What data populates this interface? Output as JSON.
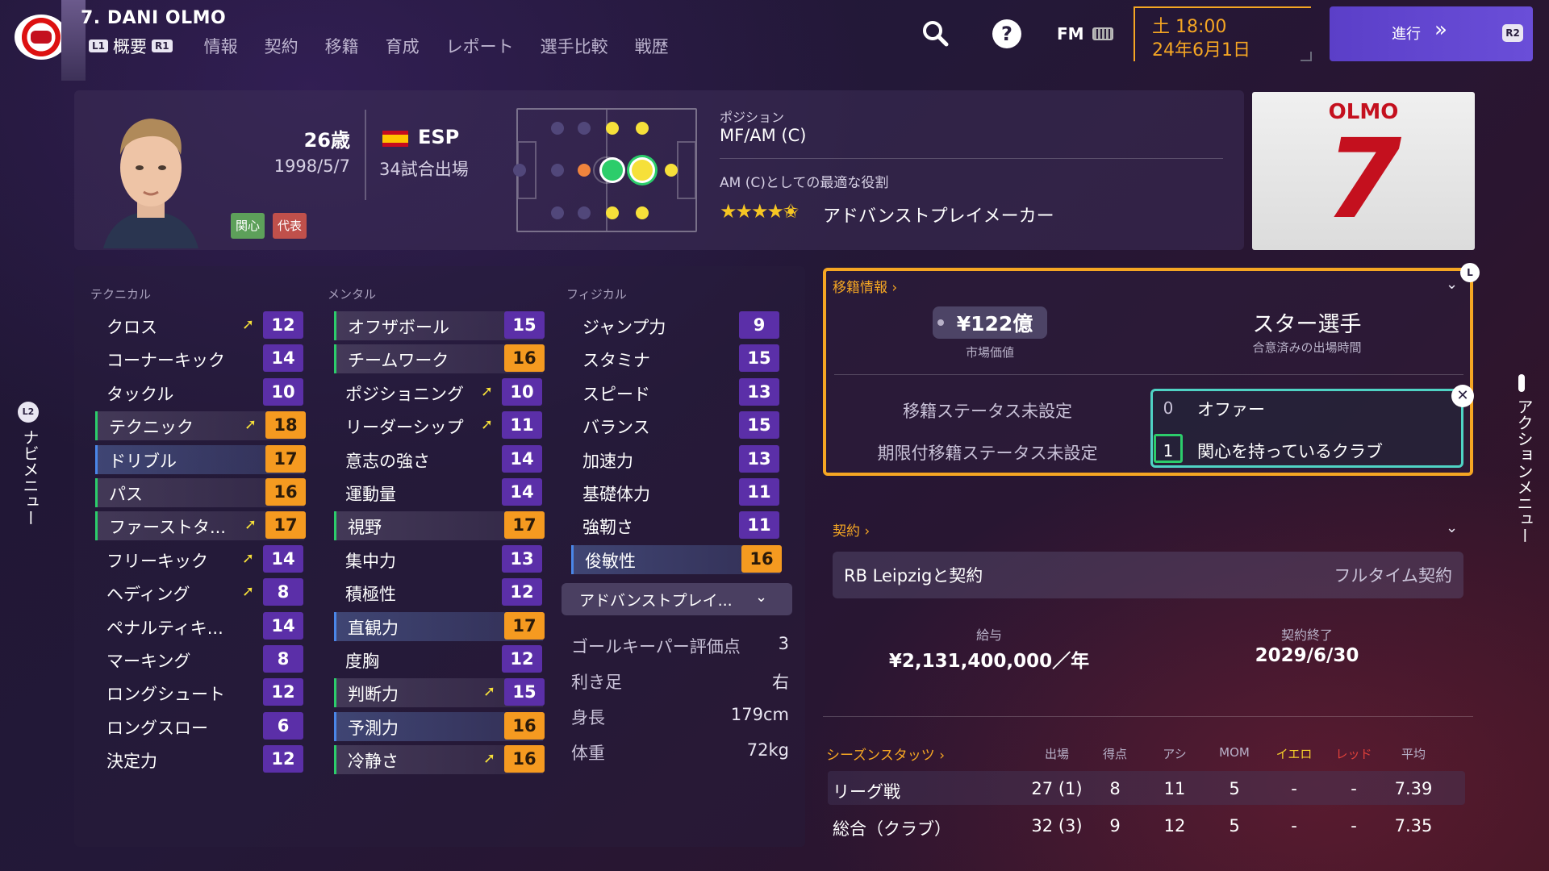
{
  "header": {
    "player_title": "7. DANI OLMO",
    "tabs": [
      {
        "label": "概要",
        "left_hint": "L1",
        "right_hint": "R1"
      },
      {
        "label": "情報"
      },
      {
        "label": "契約"
      },
      {
        "label": "移籍"
      },
      {
        "label": "育成"
      },
      {
        "label": "レポート"
      },
      {
        "label": "選手比較"
      },
      {
        "label": "戦歴"
      }
    ],
    "fm_label": "FM",
    "help_glyph": "?",
    "date_time": "土 18:00",
    "date_day": "24年6月1日",
    "continue_label": "進行",
    "continue_icon": "»",
    "continue_hint": "R2"
  },
  "profile": {
    "age": "26歳",
    "dob": "1998/5/7",
    "nation": "ESP",
    "appearances": "34試合出場",
    "badges": [
      "関心",
      "代表"
    ],
    "position_label": "ポジション",
    "position_value": "MF/AM (C)",
    "best_role_label": "AM (C)としての最適な役割",
    "role_stars": "★★★★✬",
    "role_rating_stars": 4.5,
    "role_name": "アドバンストプレイメーカー",
    "shirt_name": "OLMO",
    "shirt_number": "7"
  },
  "attributes": {
    "technical_header": "テクニカル",
    "mental_header": "メンタル",
    "physical_header": "フィジカル",
    "technical": [
      {
        "name": "クロス",
        "value": "12",
        "arrow": "➚",
        "style": "",
        "color": "purple"
      },
      {
        "name": "コーナーキック",
        "value": "14",
        "arrow": "",
        "style": "",
        "color": "purple"
      },
      {
        "name": "タックル",
        "value": "10",
        "arrow": "",
        "style": "",
        "color": "purple"
      },
      {
        "name": "テクニック",
        "value": "18",
        "arrow": "➚",
        "style": "hl-green",
        "color": "orange"
      },
      {
        "name": "ドリブル",
        "value": "17",
        "arrow": "",
        "style": "hl-blue",
        "color": "orange"
      },
      {
        "name": "パス",
        "value": "16",
        "arrow": "",
        "style": "hl-green",
        "color": "orange"
      },
      {
        "name": "ファーストタ...",
        "value": "17",
        "arrow": "➚",
        "style": "hl-green",
        "color": "orange"
      },
      {
        "name": "フリーキック",
        "value": "14",
        "arrow": "➚",
        "style": "",
        "color": "purple"
      },
      {
        "name": "ヘディング",
        "value": "8",
        "arrow": "➚",
        "style": "",
        "color": "purple"
      },
      {
        "name": "ペナルティキ...",
        "value": "14",
        "arrow": "",
        "style": "",
        "color": "purple"
      },
      {
        "name": "マーキング",
        "value": "8",
        "arrow": "",
        "style": "",
        "color": "purple"
      },
      {
        "name": "ロングシュート",
        "value": "12",
        "arrow": "",
        "style": "",
        "color": "purple"
      },
      {
        "name": "ロングスロー",
        "value": "6",
        "arrow": "",
        "style": "",
        "color": "purple"
      },
      {
        "name": "決定力",
        "value": "12",
        "arrow": "",
        "style": "",
        "color": "purple"
      }
    ],
    "mental": [
      {
        "name": "オフザボール",
        "value": "15",
        "arrow": "",
        "style": "hl-green",
        "color": "purple"
      },
      {
        "name": "チームワーク",
        "value": "16",
        "arrow": "",
        "style": "hl-green",
        "color": "orange"
      },
      {
        "name": "ポジショニング",
        "value": "10",
        "arrow": "➚",
        "style": "",
        "color": "purple"
      },
      {
        "name": "リーダーシップ",
        "value": "11",
        "arrow": "➚",
        "style": "",
        "color": "purple"
      },
      {
        "name": "意志の強さ",
        "value": "14",
        "arrow": "",
        "style": "",
        "color": "purple"
      },
      {
        "name": "運動量",
        "value": "14",
        "arrow": "",
        "style": "",
        "color": "purple"
      },
      {
        "name": "視野",
        "value": "17",
        "arrow": "",
        "style": "hl-green",
        "color": "orange"
      },
      {
        "name": "集中力",
        "value": "13",
        "arrow": "",
        "style": "",
        "color": "purple"
      },
      {
        "name": "積極性",
        "value": "12",
        "arrow": "",
        "style": "",
        "color": "purple"
      },
      {
        "name": "直観力",
        "value": "17",
        "arrow": "",
        "style": "hl-blue",
        "color": "orange"
      },
      {
        "name": "度胸",
        "value": "12",
        "arrow": "",
        "style": "",
        "color": "purple"
      },
      {
        "name": "判断力",
        "value": "15",
        "arrow": "➚",
        "style": "hl-green",
        "color": "purple"
      },
      {
        "name": "予測力",
        "value": "16",
        "arrow": "",
        "style": "hl-blue",
        "color": "orange"
      },
      {
        "name": "冷静さ",
        "value": "16",
        "arrow": "➚",
        "style": "hl-green",
        "color": "orange"
      }
    ],
    "physical": [
      {
        "name": "ジャンプ力",
        "value": "9",
        "arrow": "",
        "style": "",
        "color": "purple"
      },
      {
        "name": "スタミナ",
        "value": "15",
        "arrow": "",
        "style": "",
        "color": "purple"
      },
      {
        "name": "スピード",
        "value": "13",
        "arrow": "",
        "style": "",
        "color": "purple"
      },
      {
        "name": "バランス",
        "value": "15",
        "arrow": "",
        "style": "",
        "color": "purple"
      },
      {
        "name": "加速力",
        "value": "13",
        "arrow": "",
        "style": "",
        "color": "purple"
      },
      {
        "name": "基礎体力",
        "value": "11",
        "arrow": "",
        "style": "",
        "color": "purple"
      },
      {
        "name": "強靭さ",
        "value": "11",
        "arrow": "",
        "style": "",
        "color": "purple"
      },
      {
        "name": "俊敏性",
        "value": "16",
        "arrow": "",
        "style": "hl-blue",
        "color": "orange"
      }
    ],
    "role_select": "アドバンストプレイ...",
    "info_rows": [
      {
        "label": "ゴールキーパー評価点",
        "value": "3"
      },
      {
        "label": "利き足",
        "value": "右"
      },
      {
        "label": "身長",
        "value": "179cm"
      },
      {
        "label": "体重",
        "value": "72kg"
      }
    ]
  },
  "transfer": {
    "title": "移籍情報 ›",
    "market_value": "¥122億",
    "market_value_caption": "市場価値",
    "status": "スター選手",
    "status_caption": "合意済みの出場時間",
    "transfer_status": "移籍ステータス未設定",
    "loan_status": "期限付移籍ステータス未設定",
    "offers": [
      {
        "count": "0",
        "label": "オファー"
      },
      {
        "count": "1",
        "label": "関心を持っているクラブ"
      }
    ],
    "close_glyph": "✕",
    "lock_glyph": "L"
  },
  "contract": {
    "title": "契約 ›",
    "club": "RB Leipzigと契約",
    "type": "フルタイム契約",
    "wage_caption": "給与",
    "wage": "¥2,131,400,000／年",
    "expiry_caption": "契約終了",
    "expiry": "2029/6/30"
  },
  "season_stats": {
    "title": "シーズンスタッツ ›",
    "columns": [
      "出場",
      "得点",
      "アシ",
      "MOM",
      "イエロ",
      "レッド",
      "平均"
    ],
    "column_colors": [
      "#b8b1c8",
      "#b8b1c8",
      "#b8b1c8",
      "#b8b1c8",
      "#f6d02a",
      "#e0403a",
      "#b8b1c8"
    ],
    "rows": [
      {
        "label": "リーグ戦",
        "values": [
          "27 (1)",
          "8",
          "11",
          "5",
          "-",
          "-",
          "7.39"
        ]
      },
      {
        "label": "総合（クラブ）",
        "values": [
          "32 (3)",
          "9",
          "12",
          "5",
          "-",
          "-",
          "7.35"
        ]
      }
    ]
  },
  "side": {
    "nav_badge": "L2",
    "nav_label": "ナビメニュー",
    "action_label": "アクションメニュー"
  },
  "colors": {
    "accent_orange": "#f5a623",
    "attr_purple": "#5b2fa8",
    "attr_orange": "#f59a20",
    "continue_purple": "#5b3fc8",
    "offer_teal": "#4fd3c4"
  }
}
